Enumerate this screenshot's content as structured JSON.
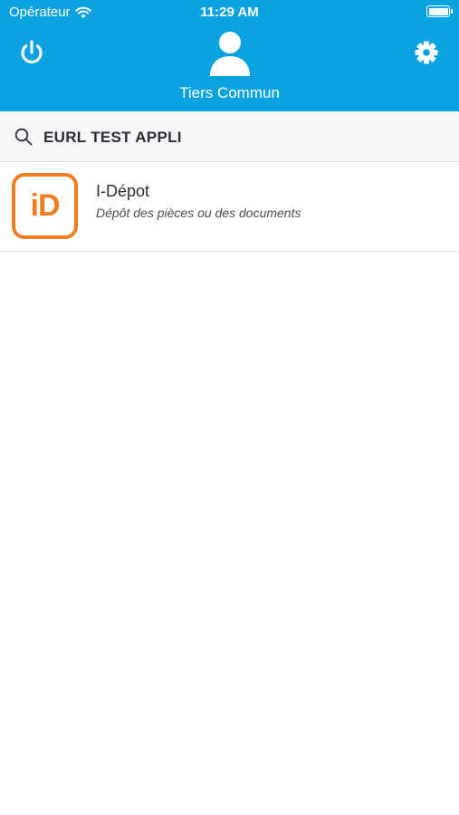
{
  "status_bar": {
    "carrier": "Opérateur",
    "time": "11:29 AM"
  },
  "header": {
    "user_name": "Tiers Commun",
    "background_color": "#0aa3e0",
    "left_icon": "power-icon",
    "right_icon": "gear-icon",
    "center_icon": "user-avatar-icon"
  },
  "search": {
    "icon": "search-icon",
    "value": "EURL TEST APPLI"
  },
  "apps": [
    {
      "icon_label": "iD",
      "icon_color": "#f07d22",
      "title": "I-Dépot",
      "subtitle": "Dépôt des pièces ou des documents"
    }
  ]
}
